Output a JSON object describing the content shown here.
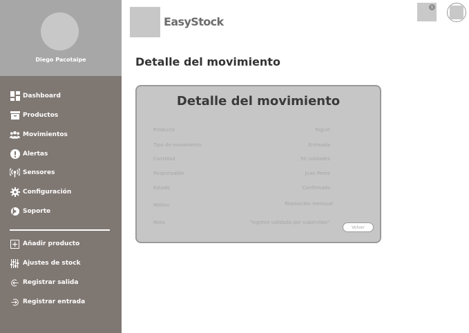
{
  "app": {
    "brand": "EasyStock",
    "notification_count": "1"
  },
  "sidebar": {
    "user_name": "Diego Pacotaipe",
    "items": [
      {
        "label": "Dashboard",
        "icon": "dashboard-icon"
      },
      {
        "label": "Productos",
        "icon": "box-icon"
      },
      {
        "label": "Movimientos",
        "icon": "users-icon"
      },
      {
        "label": "Alertas",
        "icon": "alert-icon"
      },
      {
        "label": "Sensores",
        "icon": "signal-icon"
      },
      {
        "label": "Configuración",
        "icon": "gear-icon"
      },
      {
        "label": "Soporte",
        "icon": "support-icon"
      }
    ],
    "actions": [
      {
        "label": "Añadir producto",
        "icon": "plus-icon"
      },
      {
        "label": "Ajustes de stock",
        "icon": "sliders-icon"
      },
      {
        "label": "Registrar salida",
        "icon": "exit-icon"
      },
      {
        "label": "Registrar entrada",
        "icon": "enter-icon"
      }
    ]
  },
  "main": {
    "page_title": "Detalle del movimiento",
    "card": {
      "title": "Detalle del movimiento",
      "rows": [
        {
          "label": "Producto",
          "value": "Yogurt"
        },
        {
          "label": "Tipo de movimiento",
          "value": "Entreada"
        },
        {
          "label": "Cantidad",
          "value": "50 unidades"
        },
        {
          "label": "Responsable",
          "value": "Juan Perez"
        },
        {
          "label": "Estado",
          "value": "Confirmado"
        },
        {
          "label": "Motivo",
          "value": "Reposición mensual"
        },
        {
          "label": "Nota",
          "value": "\"Ingreso validado por supervisor\""
        }
      ],
      "back_label": "Volver"
    }
  },
  "colors": {
    "sidebar_bg": "#7f7772",
    "profile_bg": "#a7a7a7",
    "card_bg": "#c6c6c6",
    "muted_text": "#a6a6a6"
  }
}
